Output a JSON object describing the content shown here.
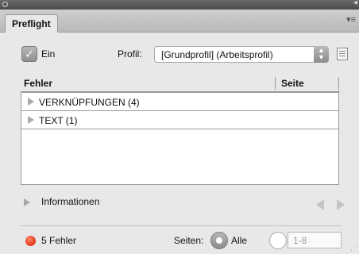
{
  "panel": {
    "tab_label": "Preflight",
    "ein_label": "Ein",
    "profil_label": "Profil:",
    "profil_value": "[Grundprofil] (Arbeitsprofil)"
  },
  "list": {
    "columns": [
      "Fehler",
      "Seite"
    ],
    "rows": [
      {
        "label": "VERKNÜPFUNGEN (4)"
      },
      {
        "label": "TEXT (1)"
      }
    ]
  },
  "info": {
    "label": "Informationen"
  },
  "footer": {
    "error_count": "5 Fehler",
    "seiten_label": "Seiten:",
    "alle_label": "Alle",
    "range_value": "1-8"
  },
  "colors": {
    "error_dot": "#e8401f",
    "tab_bg": "#e8e8e8"
  },
  "icons": {
    "check": "checkmark-icon",
    "expand": "triangle-right-icon",
    "prev": "triangle-left-icon",
    "next": "triangle-right-icon",
    "menu": "panel-menu-icon"
  }
}
